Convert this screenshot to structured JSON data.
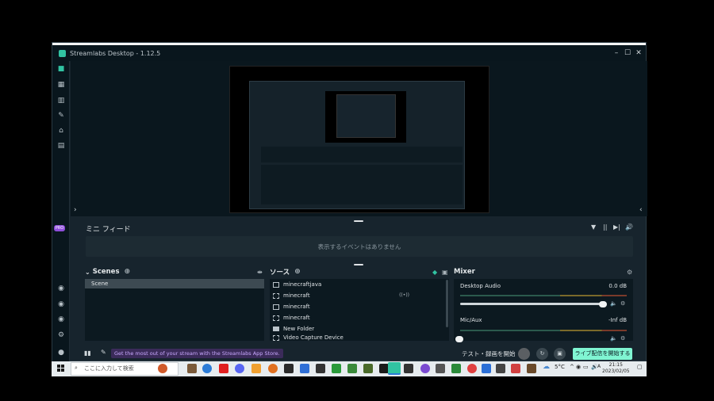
{
  "window": {
    "title": "Streamlabs Desktop - 1.12.5",
    "minimize": "–",
    "maximize": "☐",
    "close": "✕"
  },
  "nav": {
    "pro_badge": "PRO"
  },
  "mini_feed": {
    "label": "ミニ フィード",
    "empty_text": "表示するイベントはありません",
    "filter": "▼",
    "pause": "||",
    "skip": "▶|",
    "mute": "🔊"
  },
  "scenes": {
    "title": "Scenes",
    "items": [
      "Scene"
    ]
  },
  "sources": {
    "title": "ソース",
    "items": [
      {
        "name": "minecraftjava",
        "icon": "monitor-icon"
      },
      {
        "name": "minecraft",
        "icon": "window-capture-icon"
      },
      {
        "name": "minecraft",
        "icon": "file-icon"
      },
      {
        "name": "minecraft",
        "icon": "window-capture-icon"
      },
      {
        "name": "New Folder",
        "icon": "folder-icon"
      },
      {
        "name": "Video Capture Device",
        "icon": "camera-icon"
      }
    ]
  },
  "mixer": {
    "title": "Mixer",
    "channels": [
      {
        "name": "Desktop Audio",
        "db": "0.0 dB"
      },
      {
        "name": "Mic/Aux",
        "db": "-Inf dB"
      }
    ]
  },
  "statusbar": {
    "promo": "Get the most out of your stream with the Streamlabs App Store.",
    "test_label": "テスト・録画を開始",
    "go_live": "ライブ配信を開始する"
  },
  "taskbar": {
    "search_placeholder": "ここに入力して検索",
    "weather": "5°C",
    "time": "21:15",
    "date": "2023/02/05"
  },
  "colors": {
    "accent": "#31c3a2",
    "go_live": "#80f5d2",
    "bg": "#17242d"
  }
}
